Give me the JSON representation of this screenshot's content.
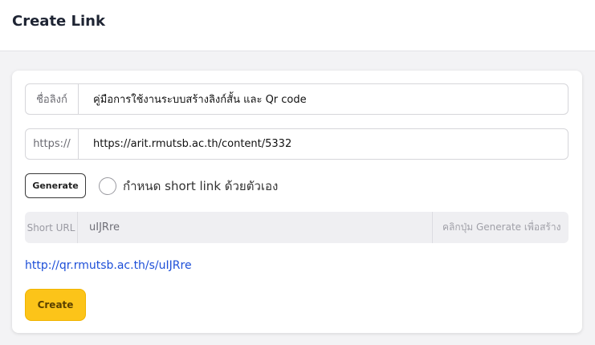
{
  "header": {
    "title": "Create Link"
  },
  "form": {
    "name_prefix": "ชื่อลิงก์",
    "name_value": "คู่มือการใช้งานระบบสร้างลิงก์สั้น และ Qr code",
    "url_prefix": "https://",
    "url_value": "https://arit.rmutsb.ac.th/content/5332",
    "generate_label": "Generate",
    "custom_label": "กำหนด short link ด้วยตัวเอง",
    "custom_checked": false,
    "short_prefix": "Short URL",
    "short_value": "uIJRre",
    "short_hint": "คลิกปุ่ม Generate เพื่อสร้าง",
    "result_link": "http://qr.rmutsb.ac.th/s/uIJRre",
    "create_label": "Create"
  },
  "colors": {
    "accent": "#fcc419",
    "link": "#1d4fd8",
    "background": "#f3f3f5"
  }
}
